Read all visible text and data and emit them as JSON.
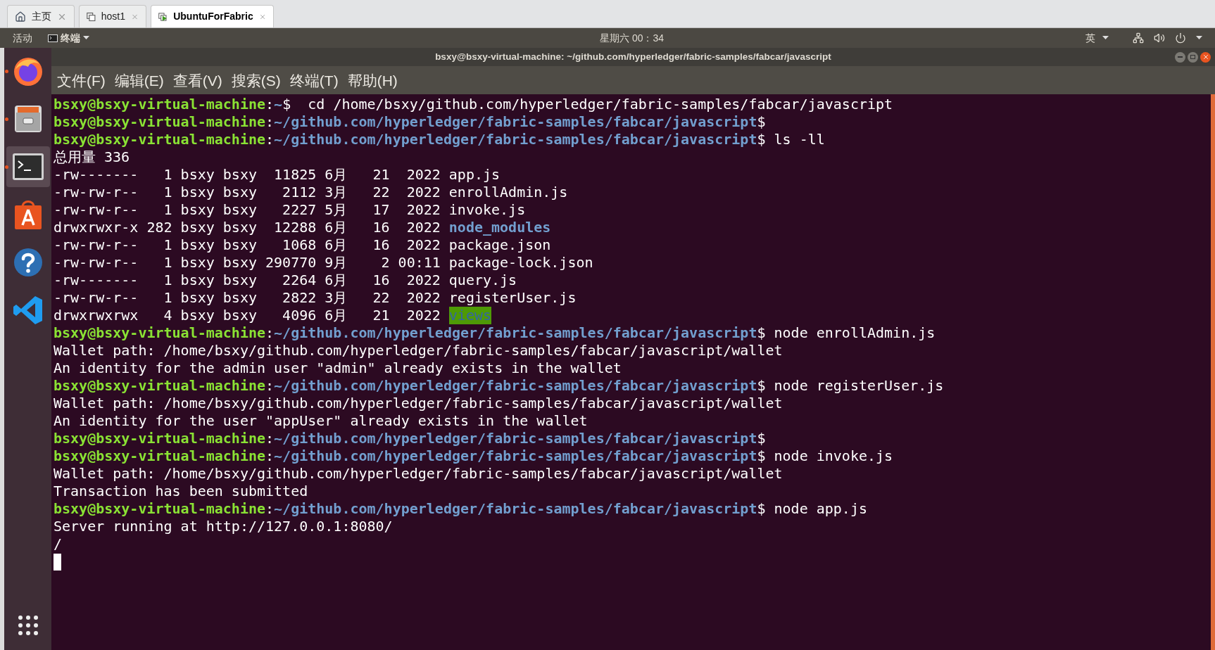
{
  "host_tabs": [
    {
      "label": "主页",
      "kind": "home",
      "selected": false
    },
    {
      "label": "host1",
      "kind": "vm",
      "selected": false
    },
    {
      "label": "UbuntuForFabric",
      "kind": "vm_running",
      "selected": true
    }
  ],
  "top_bar": {
    "activities": "活动",
    "app_menu": "终端",
    "clock": "星期六 00：34",
    "input_method": "英"
  },
  "dock": [
    {
      "kind": "firefox",
      "running": true,
      "active": false
    },
    {
      "kind": "files",
      "running": true,
      "active": false
    },
    {
      "kind": "terminal",
      "running": true,
      "active": true
    },
    {
      "kind": "software",
      "running": false,
      "active": false
    },
    {
      "kind": "help",
      "running": false,
      "active": false
    },
    {
      "kind": "vscode",
      "running": false,
      "active": false
    }
  ],
  "window": {
    "title": "bsxy@bsxy-virtual-machine: ~/github.com/hyperledger/fabric-samples/fabcar/javascript"
  },
  "menu": [
    "文件(F)",
    "编辑(E)",
    "查看(V)",
    "搜索(S)",
    "终端(T)",
    "帮助(H)"
  ],
  "terminal": [
    {
      "kind": "prompt",
      "user": "bsxy@bsxy-virtual-machine",
      "sep": ":",
      "path": "~",
      "sign": "$",
      "command": "  cd /home/bsxy/github.com/hyperledger/fabric-samples/fabcar/javascript"
    },
    {
      "kind": "prompt",
      "user": "bsxy@bsxy-virtual-machine",
      "sep": ":",
      "path": "~/github.com/hyperledger/fabric-samples/fabcar/javascript",
      "sign": "$"
    },
    {
      "kind": "prompt",
      "user": "bsxy@bsxy-virtual-machine",
      "sep": ":",
      "path": "~/github.com/hyperledger/fabric-samples/fabcar/javascript",
      "sign": "$",
      "command": " ls -ll"
    },
    {
      "kind": "output",
      "text": "总用量 336"
    },
    {
      "kind": "listing_file",
      "info": "-rw-------   1 bsxy bsxy  11825 6月   21  2022",
      "name": "app.js"
    },
    {
      "kind": "listing_file",
      "info": "-rw-rw-r--   1 bsxy bsxy   2112 3月   22  2022",
      "name": "enrollAdmin.js"
    },
    {
      "kind": "listing_file",
      "info": "-rw-rw-r--   1 bsxy bsxy   2227 5月   17  2022",
      "name": "invoke.js"
    },
    {
      "kind": "listing_dir",
      "info": "drwxrwxr-x 282 bsxy bsxy  12288 6月   16  2022",
      "name": "node_modules"
    },
    {
      "kind": "listing_file",
      "info": "-rw-rw-r--   1 bsxy bsxy   1068 6月   16  2022",
      "name": "package.json"
    },
    {
      "kind": "listing_file",
      "info": "-rw-rw-r--   1 bsxy bsxy 290770 9月    2 00:11",
      "name": "package-lock.json"
    },
    {
      "kind": "listing_file",
      "info": "-rw-------   1 bsxy bsxy   2264 6月   16  2022",
      "name": "query.js"
    },
    {
      "kind": "listing_file",
      "info": "-rw-rw-r--   1 bsxy bsxy   2822 3月   22  2022",
      "name": "registerUser.js"
    },
    {
      "kind": "listing_dir_writable",
      "info": "drwxrwxrwx   4 bsxy bsxy   4096 6月   21  2022",
      "name": "views"
    },
    {
      "kind": "prompt",
      "user": "bsxy@bsxy-virtual-machine",
      "sep": ":",
      "path": "~/github.com/hyperledger/fabric-samples/fabcar/javascript",
      "sign": "$",
      "command": " node enrollAdmin.js"
    },
    {
      "kind": "output",
      "text": "Wallet path: /home/bsxy/github.com/hyperledger/fabric-samples/fabcar/javascript/wallet"
    },
    {
      "kind": "output",
      "text": "An identity for the admin user \"admin\" already exists in the wallet"
    },
    {
      "kind": "prompt",
      "user": "bsxy@bsxy-virtual-machine",
      "sep": ":",
      "path": "~/github.com/hyperledger/fabric-samples/fabcar/javascript",
      "sign": "$",
      "command": " node registerUser.js"
    },
    {
      "kind": "output",
      "text": "Wallet path: /home/bsxy/github.com/hyperledger/fabric-samples/fabcar/javascript/wallet"
    },
    {
      "kind": "output",
      "text": "An identity for the user \"appUser\" already exists in the wallet"
    },
    {
      "kind": "prompt",
      "user": "bsxy@bsxy-virtual-machine",
      "sep": ":",
      "path": "~/github.com/hyperledger/fabric-samples/fabcar/javascript",
      "sign": "$"
    },
    {
      "kind": "prompt",
      "user": "bsxy@bsxy-virtual-machine",
      "sep": ":",
      "path": "~/github.com/hyperledger/fabric-samples/fabcar/javascript",
      "sign": "$",
      "command": " node invoke.js"
    },
    {
      "kind": "output",
      "text": "Wallet path: /home/bsxy/github.com/hyperledger/fabric-samples/fabcar/javascript/wallet"
    },
    {
      "kind": "output",
      "text": "Transaction has been submitted"
    },
    {
      "kind": "prompt",
      "user": "bsxy@bsxy-virtual-machine",
      "sep": ":",
      "path": "~/github.com/hyperledger/fabric-samples/fabcar/javascript",
      "sign": "$",
      "command": " node app.js"
    },
    {
      "kind": "output",
      "text": "Server running at http://127.0.0.1:8080/"
    },
    {
      "kind": "output",
      "text": "/"
    },
    {
      "kind": "cursor"
    }
  ]
}
